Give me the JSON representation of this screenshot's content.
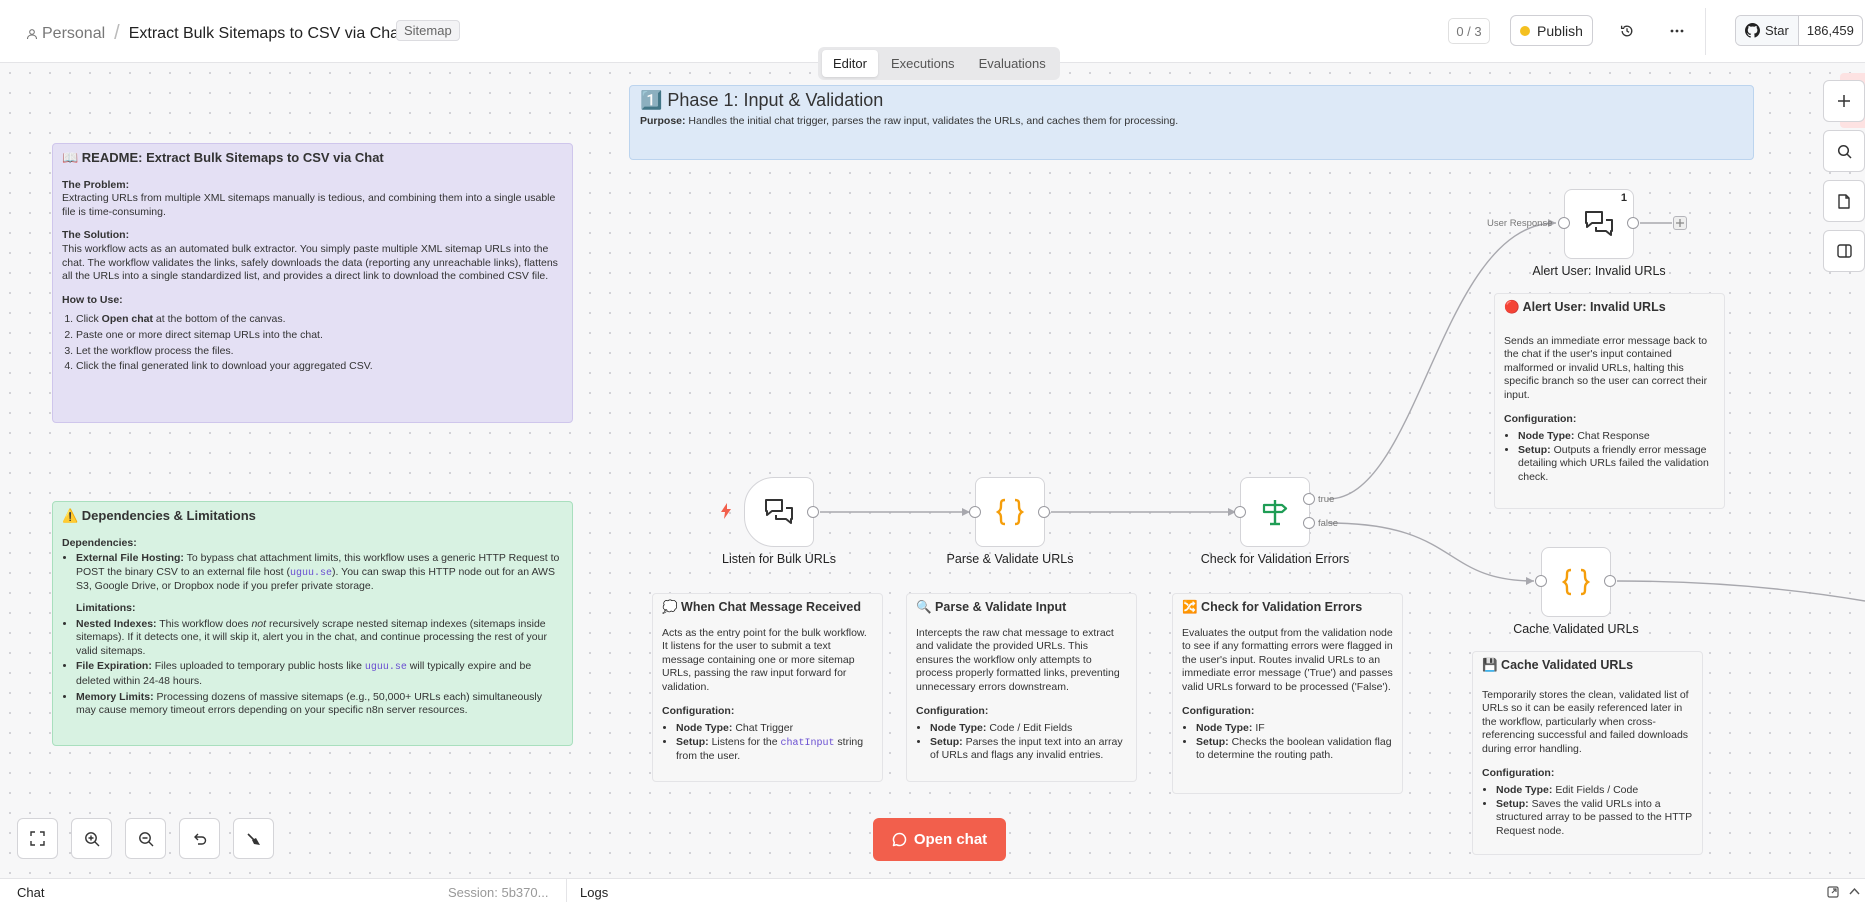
{
  "header": {
    "workspace": "Personal",
    "separator": "/",
    "title": "Extract Bulk Sitemaps to CSV via Chat",
    "tag": "Sitemap",
    "counter": "0 / 3",
    "publish": "Publish",
    "github_star": "Star",
    "github_count": "186,459"
  },
  "tabs": [
    "Editor",
    "Executions",
    "Evaluations"
  ],
  "phase": {
    "title": "1️⃣ Phase 1: Input & Validation",
    "purpose_label": "Purpose:",
    "purpose": " Handles the initial chat trigger, parses the raw input, validates the URLs, and caches them for processing."
  },
  "readme": {
    "title": "📖 README: Extract Bulk Sitemaps to CSV via Chat",
    "problem_h": "The Problem:",
    "problem": "Extracting URLs from multiple XML sitemaps manually is tedious, and combining them into a single usable file is time-consuming.",
    "solution_h": "The Solution:",
    "solution": "This workflow acts as an automated bulk extractor. You simply paste multiple XML sitemap URLs into the chat. The workflow validates the links, safely downloads the data (reporting any unreachable links), flattens all the URLs into a single standardized list, and provides a direct link to download the combined CSV file.",
    "howto_h": "How to Use:",
    "step1_a": "Click ",
    "step1_b": "Open chat",
    "step1_c": " at the bottom of the canvas.",
    "step2": "Paste one or more direct sitemap URLs into the chat.",
    "step3": "Let the workflow process the files.",
    "step4": "Click the final generated link to download your aggregated CSV."
  },
  "deps": {
    "title": "⚠️ Dependencies & Limitations",
    "dep_h": "Dependencies:",
    "d1_b": "External File Hosting:",
    "d1_a": " To bypass chat attachment limits, this workflow uses a generic HTTP Request to POST the binary CSV to an external file host (",
    "d1_code": "uguu.se",
    "d1_c": "). You can swap this HTTP node out for an AWS S3, Google Drive, or Dropbox node if you prefer private storage.",
    "lim_h": "Limitations:",
    "l1_b": "Nested Indexes:",
    "l1_a": " This workflow does ",
    "l1_i": "not",
    "l1_c": " recursively scrape nested sitemap indexes (sitemaps inside sitemaps). If it detects one, it will skip it, alert you in the chat, and continue processing the rest of your valid sitemaps.",
    "l2_b": "File Expiration:",
    "l2_a": " Files uploaded to temporary public hosts like ",
    "l2_code": "uguu.se",
    "l2_c": " will typically expire and be deleted within 24-48 hours.",
    "l3_b": "Memory Limits:",
    "l3_a": " Processing dozens of massive sitemaps (e.g., 50,000+ URLs each) simultaneously may cause memory timeout errors depending on your specific n8n server resources."
  },
  "nodes": {
    "n1": "Listen for Bulk URLs",
    "n2": "Parse & Validate URLs",
    "n3": "Check for Validation Errors",
    "n4": "Alert User: Invalid URLs",
    "n5": "Cache Validated URLs",
    "true_label": "true",
    "false_label": "false",
    "user_response": "User Response",
    "badge": "1"
  },
  "d_chat": {
    "title": "💭 When Chat Message Received",
    "body": "Acts as the entry point for the bulk workflow. It listens for the user to submit a text message containing one or more sitemap URLs, passing the raw input forward for validation.",
    "cfg": "Configuration:",
    "nt_b": "Node Type:",
    "nt": " Chat Trigger",
    "su_b": "Setup:",
    "su_a": " Listens for the ",
    "su_code": "chatInput",
    "su_c": " string from the user."
  },
  "d_parse": {
    "title": "🔍 Parse & Validate Input",
    "body": "Intercepts the raw chat message to extract and validate the provided URLs. This ensures the workflow only attempts to process properly formatted links, preventing unnecessary errors downstream.",
    "cfg": "Configuration:",
    "nt_b": "Node Type:",
    "nt": " Code / Edit Fields",
    "su_b": "Setup:",
    "su": " Parses the input text into an array of URLs and flags any invalid entries."
  },
  "d_check": {
    "title": "🔀 Check for Validation Errors",
    "body": "Evaluates the output from the validation node to see if any formatting errors were flagged in the user's input. Routes invalid URLs to an immediate error message ('True') and passes valid URLs forward to be processed ('False').",
    "cfg": "Configuration:",
    "nt_b": "Node Type:",
    "nt": " IF",
    "su_b": "Setup:",
    "su": " Checks the boolean validation flag to determine the routing path."
  },
  "d_alert": {
    "title": "🔴 Alert User: Invalid URLs",
    "body": "Sends an immediate error message back to the chat if the user's input contained malformed or invalid URLs, halting this specific branch so the user can correct their input.",
    "cfg": "Configuration:",
    "nt_b": "Node Type:",
    "nt": " Chat Response",
    "su_b": "Setup:",
    "su": " Outputs a friendly error message detailing which URLs failed the validation check."
  },
  "d_cache": {
    "title": "💾 Cache Validated URLs",
    "body": "Temporarily stores the clean, validated list of URLs so it can be easily referenced later in the workflow, particularly when cross-referencing successful and failed downloads during error handling.",
    "cfg": "Configuration:",
    "nt_b": "Node Type:",
    "nt": " Edit Fields / Code",
    "su_b": "Setup:",
    "su": " Saves the valid URLs into a structured array to be passed to the HTTP Request node."
  },
  "open_chat": "Open chat",
  "bottom": {
    "chat": "Chat",
    "session": "Session: 5b370...",
    "logs": "Logs"
  },
  "icons": {
    "user": "user-icon",
    "history": "history-icon",
    "more": "more-icon",
    "github": "github-icon",
    "plus": "plus-icon",
    "search": "search-icon",
    "sticky": "sticky-note-icon",
    "panel": "panel-icon",
    "fit": "fit-view-icon",
    "zoom_in": "zoom-in-icon",
    "zoom_out": "zoom-out-icon",
    "undo": "undo-icon",
    "clean": "tidy-up-icon",
    "bolt": "bolt-icon",
    "chat": "chat-icon",
    "braces": "braces-icon",
    "signpost": "signpost-icon"
  },
  "colors": {
    "accent": "#f25f4c",
    "warning_dot": "#f4c020",
    "node_green": "#1f9d55",
    "node_orange": "#f59e0b",
    "sticky_purple": "#e4e0f4",
    "sticky_green": "#d8f2e2",
    "sticky_blue": "#dde9f7"
  }
}
